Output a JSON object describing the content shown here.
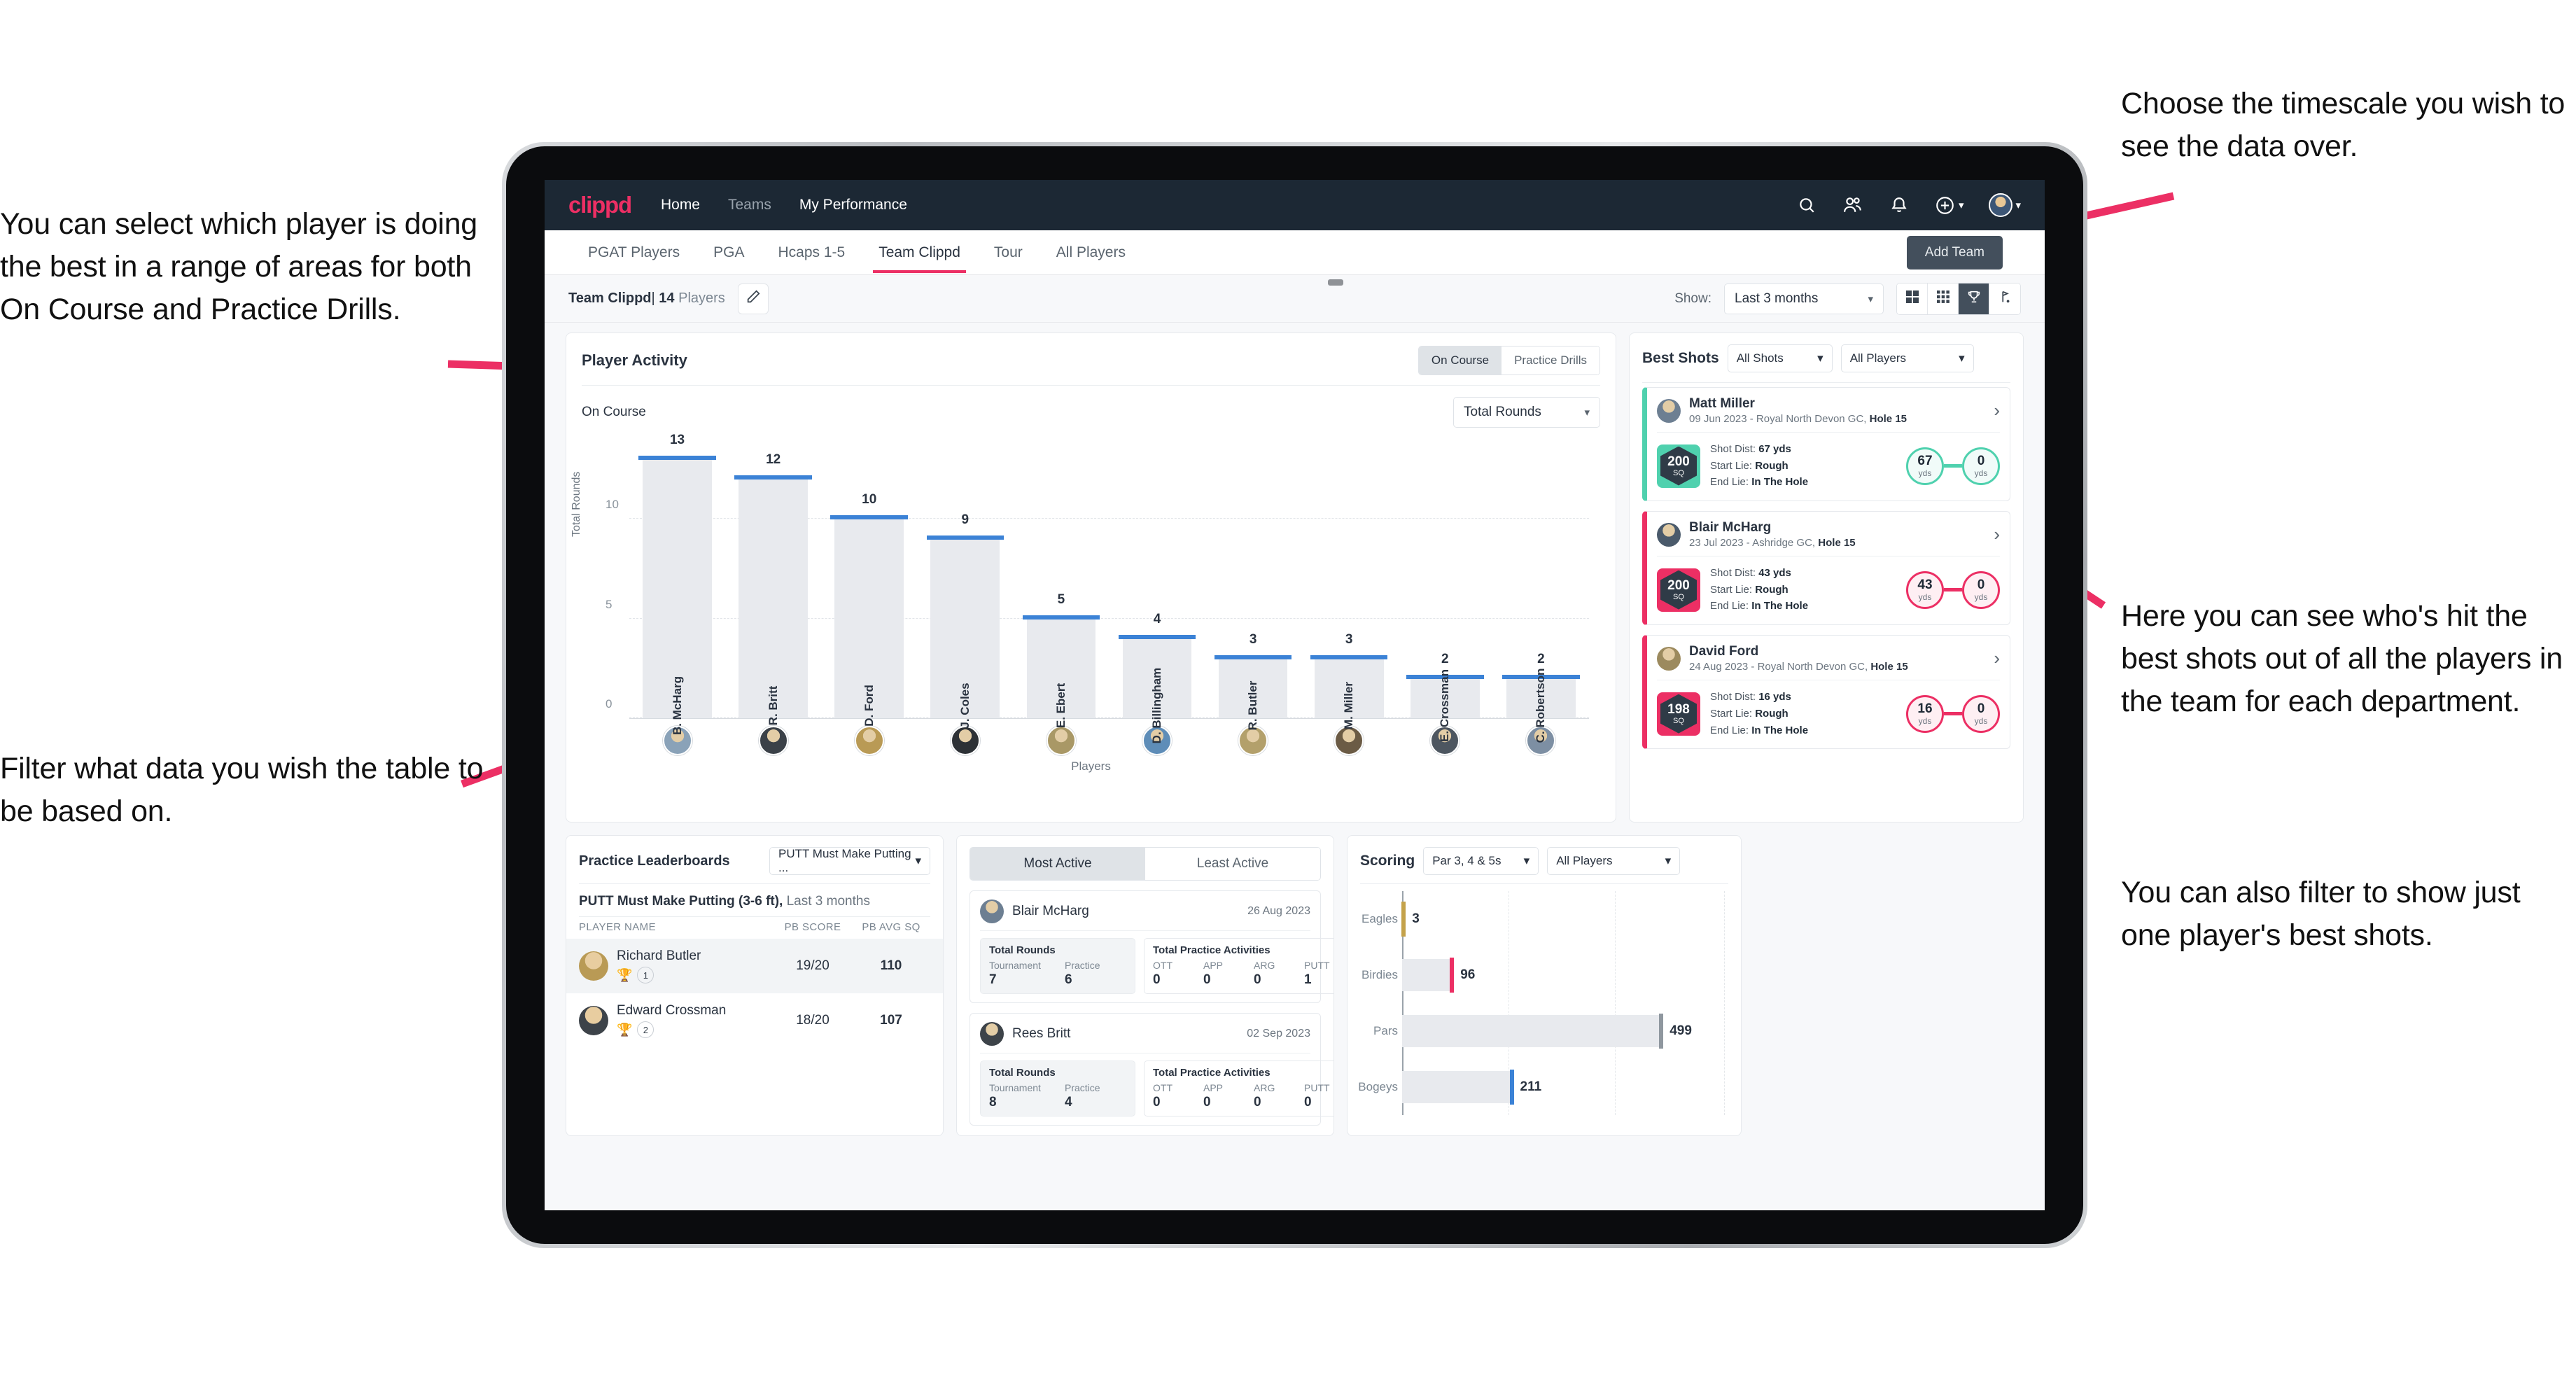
{
  "annotations": {
    "player_select": "You can select which player is doing the best in a range of areas for both On Course and Practice Drills.",
    "filter_table": "Filter what data you wish the table to be based on.",
    "timescale": "Choose the timescale you wish to see the data over.",
    "best_shots": "Here you can see who's hit the best shots out of all the players in the team for each department.",
    "filter_player": "You can also filter to show just one player's best shots."
  },
  "navbar": {
    "logo": "clippd",
    "links": [
      {
        "label": "Home",
        "active": true
      },
      {
        "label": "Teams",
        "active": false
      },
      {
        "label": "My Performance",
        "active": true
      }
    ],
    "icons": [
      "search-icon",
      "people-icon",
      "bell-icon",
      "plus-circle-icon"
    ],
    "avatar": "user-avatar"
  },
  "subnav": {
    "tabs": [
      {
        "label": "PGAT Players",
        "active": false
      },
      {
        "label": "PGA",
        "active": false
      },
      {
        "label": "Hcaps 1-5",
        "active": false
      },
      {
        "label": "Team Clippd",
        "active": true
      },
      {
        "label": "Tour",
        "active": false
      },
      {
        "label": "All Players",
        "active": false
      }
    ],
    "add_team_label": "Add Team"
  },
  "teambar": {
    "team_name": "Team Clippd",
    "separator": "|",
    "player_count": "14",
    "players_word": "Players",
    "edit_icon": "pencil-icon",
    "show_label": "Show:",
    "timescale_value": "Last 3 months",
    "view_toggles": [
      {
        "icon": "grid-4-icon",
        "active": false
      },
      {
        "icon": "grid-9-icon",
        "active": false
      },
      {
        "icon": "trophy-icon",
        "active": true
      },
      {
        "icon": "golf-flag-icon",
        "active": false
      }
    ]
  },
  "player_activity": {
    "title": "Player Activity",
    "segments": [
      {
        "label": "On Course",
        "active": true
      },
      {
        "label": "Practice Drills",
        "active": false
      }
    ],
    "sub_title": "On Course",
    "metric_select": "Total Rounds"
  },
  "chart_data": [
    {
      "type": "bar",
      "title": "Player Activity - On Course",
      "xlabel": "Players",
      "ylabel": "Total Rounds",
      "categories": [
        "B. McHarg",
        "R. Britt",
        "D. Ford",
        "J. Coles",
        "E. Ebert",
        "D. Billingham",
        "R. Butler",
        "M. Miller",
        "E. Crossman",
        "C. Robertson"
      ],
      "values": [
        13,
        12,
        10,
        9,
        5,
        4,
        3,
        3,
        2,
        2
      ],
      "yticks": [
        0,
        5,
        10
      ],
      "ylim": [
        0,
        14
      ],
      "grid": true,
      "bar_color": "#e8eaee",
      "cap_color": "#3b82d6"
    },
    {
      "type": "bar",
      "orientation": "horizontal",
      "title": "Scoring",
      "xlabel": "",
      "ylabel": "",
      "categories": [
        "Eagles",
        "Birdies",
        "Pars",
        "Bogeys"
      ],
      "values": [
        3,
        96,
        499,
        211
      ],
      "xlim": [
        0,
        620
      ],
      "grid": true,
      "cap_colors": [
        "#c4a24a",
        "#ec2f64",
        "#8f979f",
        "#3b82d6"
      ],
      "bar_color": "#e8eaee"
    }
  ],
  "best_shots": {
    "title": "Best Shots",
    "shot_filter": "All Shots",
    "player_filter": "All Players",
    "shots": [
      {
        "player": "Matt Miller",
        "meta_date": "09 Jun 2023 - Royal North Devon GC,",
        "meta_hole": "Hole 15",
        "sq": "200",
        "sq_unit": "SQ",
        "shot_dist_label": "Shot Dist:",
        "shot_dist": "67 yds",
        "start_lie_label": "Start Lie:",
        "start_lie": "Rough",
        "end_lie_label": "End Lie:",
        "end_lie": "In The Hole",
        "from_val": "67",
        "from_unit": "yds",
        "to_val": "0",
        "to_unit": "yds",
        "accent": "#4fd1ae"
      },
      {
        "player": "Blair McHarg",
        "meta_date": "23 Jul 2023 - Ashridge GC,",
        "meta_hole": "Hole 15",
        "sq": "200",
        "sq_unit": "SQ",
        "shot_dist_label": "Shot Dist:",
        "shot_dist": "43 yds",
        "start_lie_label": "Start Lie:",
        "start_lie": "Rough",
        "end_lie_label": "End Lie:",
        "end_lie": "In The Hole",
        "from_val": "43",
        "from_unit": "yds",
        "to_val": "0",
        "to_unit": "yds",
        "accent": "#ec2f64"
      },
      {
        "player": "David Ford",
        "meta_date": "24 Aug 2023 - Royal North Devon GC,",
        "meta_hole": "Hole 15",
        "sq": "198",
        "sq_unit": "SQ",
        "shot_dist_label": "Shot Dist:",
        "shot_dist": "16 yds",
        "start_lie_label": "Start Lie:",
        "start_lie": "Rough",
        "end_lie_label": "End Lie:",
        "end_lie": "In The Hole",
        "from_val": "16",
        "from_unit": "yds",
        "to_val": "0",
        "to_unit": "yds",
        "accent": "#ec2f64"
      }
    ]
  },
  "practice_leaderboards": {
    "title": "Practice Leaderboards",
    "drill_select": "PUTT Must Make Putting ...",
    "sub_title": "PUTT Must Make Putting (3-6 ft),",
    "sub_period": "Last 3 months",
    "columns": [
      "PLAYER NAME",
      "PB SCORE",
      "PB AVG SQ"
    ],
    "rows": [
      {
        "name": "Richard Butler",
        "trophy": "gold",
        "rank": "1",
        "pb_score": "19/20",
        "pb_avg_sq": "110"
      },
      {
        "name": "Edward Crossman",
        "trophy": "silver",
        "rank": "2",
        "pb_score": "18/20",
        "pb_avg_sq": "107"
      }
    ]
  },
  "activity_panel": {
    "tabs": [
      {
        "label": "Most Active",
        "active": true
      },
      {
        "label": "Least Active",
        "active": false
      }
    ],
    "rounds_title": "Total Rounds",
    "rounds_keys": [
      "Tournament",
      "Practice"
    ],
    "practice_title": "Total Practice Activities",
    "practice_keys": [
      "OTT",
      "APP",
      "ARG",
      "PUTT"
    ],
    "entries": [
      {
        "name": "Blair McHarg",
        "date": "26 Aug 2023",
        "rounds": [
          "7",
          "6"
        ],
        "practice": [
          "0",
          "0",
          "0",
          "1"
        ]
      },
      {
        "name": "Rees Britt",
        "date": "02 Sep 2023",
        "rounds": [
          "8",
          "4"
        ],
        "practice": [
          "0",
          "0",
          "0",
          "0"
        ]
      }
    ]
  },
  "scoring": {
    "title": "Scoring",
    "par_filter": "Par 3, 4 & 5s",
    "player_filter": "All Players"
  }
}
